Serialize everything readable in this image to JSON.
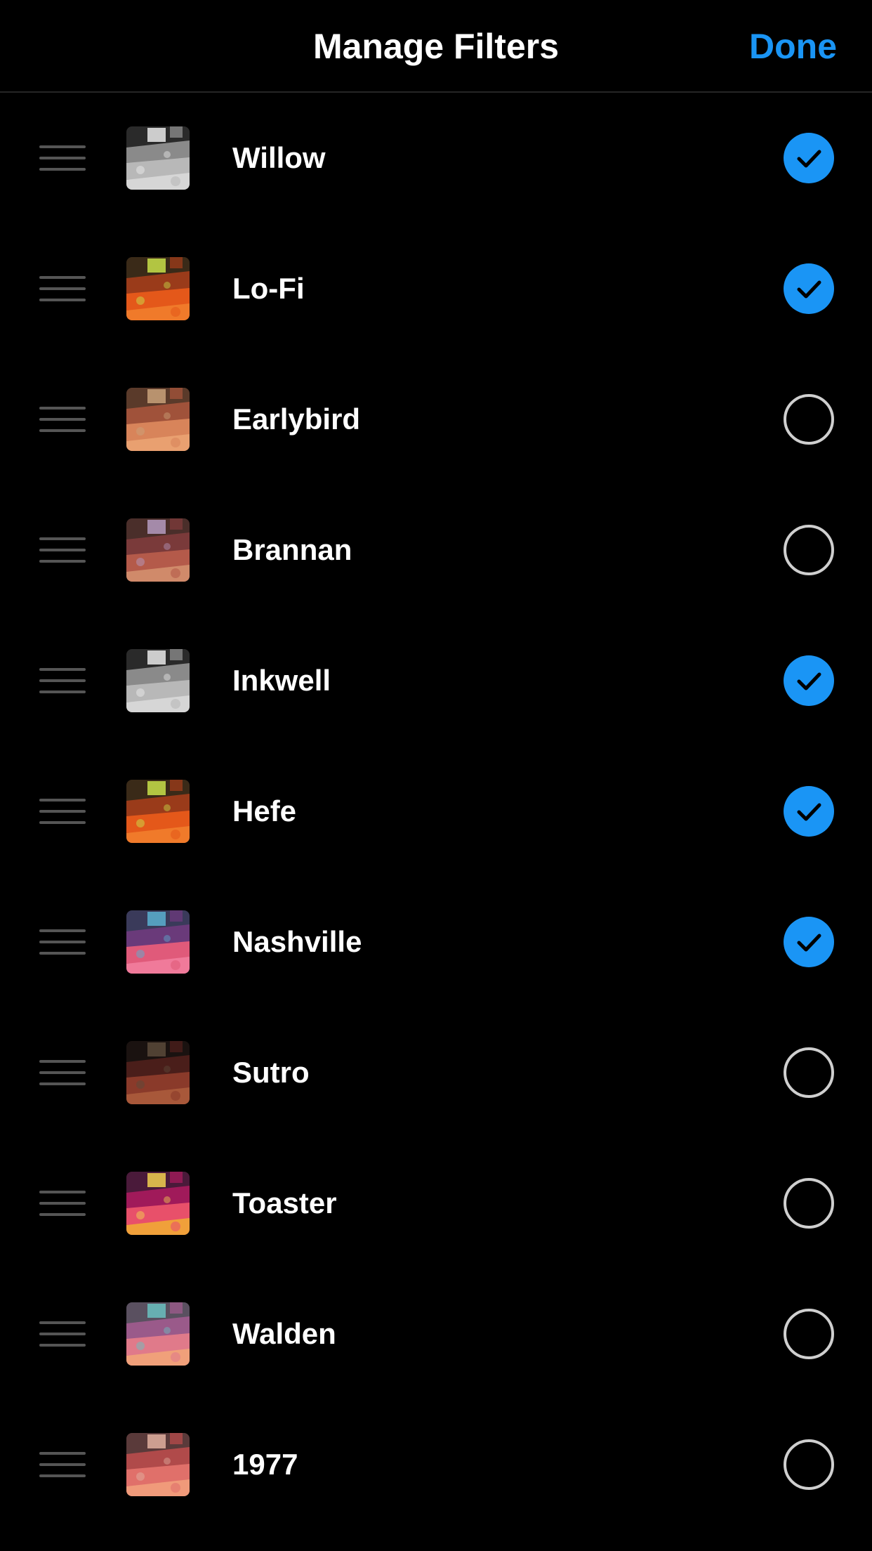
{
  "header": {
    "title": "Manage Filters",
    "done_label": "Done"
  },
  "colors": {
    "accent": "#1a95f5",
    "background": "#000000",
    "divider": "#262626",
    "handle": "#555555",
    "unchecked_ring": "#cfcfcf"
  },
  "filters": [
    {
      "name": "Willow",
      "enabled": true,
      "thumb": "mono"
    },
    {
      "name": "Lo-Fi",
      "enabled": true,
      "thumb": "vivid"
    },
    {
      "name": "Earlybird",
      "enabled": false,
      "thumb": "warm"
    },
    {
      "name": "Brannan",
      "enabled": false,
      "thumb": "muted"
    },
    {
      "name": "Inkwell",
      "enabled": true,
      "thumb": "mono"
    },
    {
      "name": "Hefe",
      "enabled": true,
      "thumb": "vivid"
    },
    {
      "name": "Nashville",
      "enabled": true,
      "thumb": "pink"
    },
    {
      "name": "Sutro",
      "enabled": false,
      "thumb": "dark"
    },
    {
      "name": "Toaster",
      "enabled": false,
      "thumb": "magenta"
    },
    {
      "name": "Walden",
      "enabled": false,
      "thumb": "pastel"
    },
    {
      "name": "1977",
      "enabled": false,
      "thumb": "rose"
    }
  ]
}
